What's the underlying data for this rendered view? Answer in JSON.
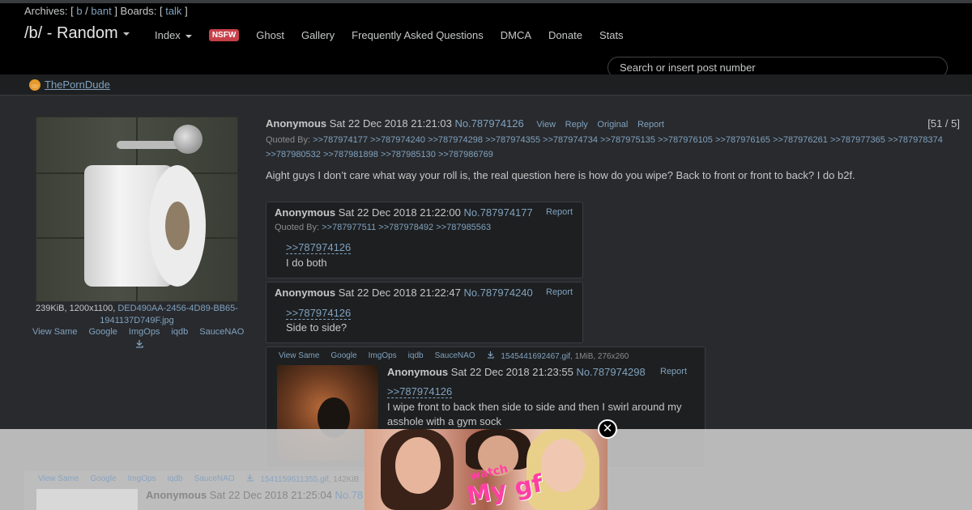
{
  "topbar": {
    "archives_label": "Archives: [",
    "archives_b": "b",
    "archives_sep": " / ",
    "archives_bant": "bant",
    "boards_label": "] Boards: [",
    "boards_talk": "talk",
    "boards_close": "]",
    "board_title": "/b/ - Random",
    "nav": {
      "index": "Index",
      "nsfw": "NSFW",
      "ghost": "Ghost",
      "gallery": "Gallery",
      "faq": "Frequently Asked Questions",
      "dmca": "DMCA",
      "donate": "Donate",
      "stats": "Stats"
    },
    "search_placeholder": "Search or insert post number"
  },
  "sponsor": {
    "label": "ThePornDude"
  },
  "op": {
    "file_info_prefix": "239KiB, 1200x1100, ",
    "file_name": "DED490AA-2456-4D89-BB65-1941137D749F.jpg",
    "tools": [
      "View Same",
      "Google",
      "ImgOps",
      "iqdb",
      "SauceNAO"
    ],
    "name": "Anonymous",
    "date": "Sat 22 Dec 2018 21:21:03",
    "number": "No.787974126",
    "actions": [
      "View",
      "Reply",
      "Original",
      "Report"
    ],
    "counter": "[51 / 5]",
    "quoted_by_label": "Quoted By:",
    "quoted_by": [
      ">>787974177",
      ">>787974240",
      ">>787974298",
      ">>787974355",
      ">>787974734",
      ">>787975135",
      ">>787976105",
      ">>787976165",
      ">>787976261",
      ">>787977365",
      ">>787978374",
      ">>787980532",
      ">>787981898",
      ">>787985130",
      ">>787986769"
    ],
    "body": "Aight guys I don’t care what way your roll is, the real question here is how do you wipe? Back to front or front to back? I do b2f."
  },
  "replies": [
    {
      "name": "Anonymous",
      "date": "Sat 22 Dec 2018 21:22:00",
      "number": "No.787974177",
      "report": "Report",
      "quoted_by_label": "Quoted By:",
      "quoted_by": [
        ">>787977511",
        ">>787978492",
        ">>787985563"
      ],
      "quote": ">>787974126",
      "text": "I do both"
    },
    {
      "name": "Anonymous",
      "date": "Sat 22 Dec 2018 21:22:47",
      "number": "No.787974240",
      "report": "Report",
      "quote": ">>787974126",
      "text": "Side to side?"
    },
    {
      "tools": [
        "View Same",
        "Google",
        "ImgOps",
        "iqdb",
        "SauceNAO"
      ],
      "file_name": "1545441692467.gif",
      "file_meta": ", 1MiB, 276x260",
      "name": "Anonymous",
      "date": "Sat 22 Dec 2018 21:23:55",
      "number": "No.787974298",
      "report": "Report",
      "quote": ">>787974126",
      "text_line1": "I wipe front to back then side to side and then I swirl around my",
      "text_line2": "asshole with a gym sock"
    },
    {
      "tools": [
        "View Same",
        "Google",
        "ImgOps",
        "iqdb",
        "SauceNAO"
      ],
      "file_name": "1541159611355.gif",
      "file_meta": ", 142KiB",
      "name": "Anonymous",
      "date": "Sat 22 Dec 2018 21:25:04",
      "number": "No.78"
    }
  ],
  "ad": {
    "logo_top": "watch",
    "logo_bottom": "My gf",
    "close": "✕"
  },
  "colors": {
    "link": "#81a2be",
    "nsfw": "#c74048",
    "background": "#282a2e",
    "post": "#1d1f21"
  }
}
